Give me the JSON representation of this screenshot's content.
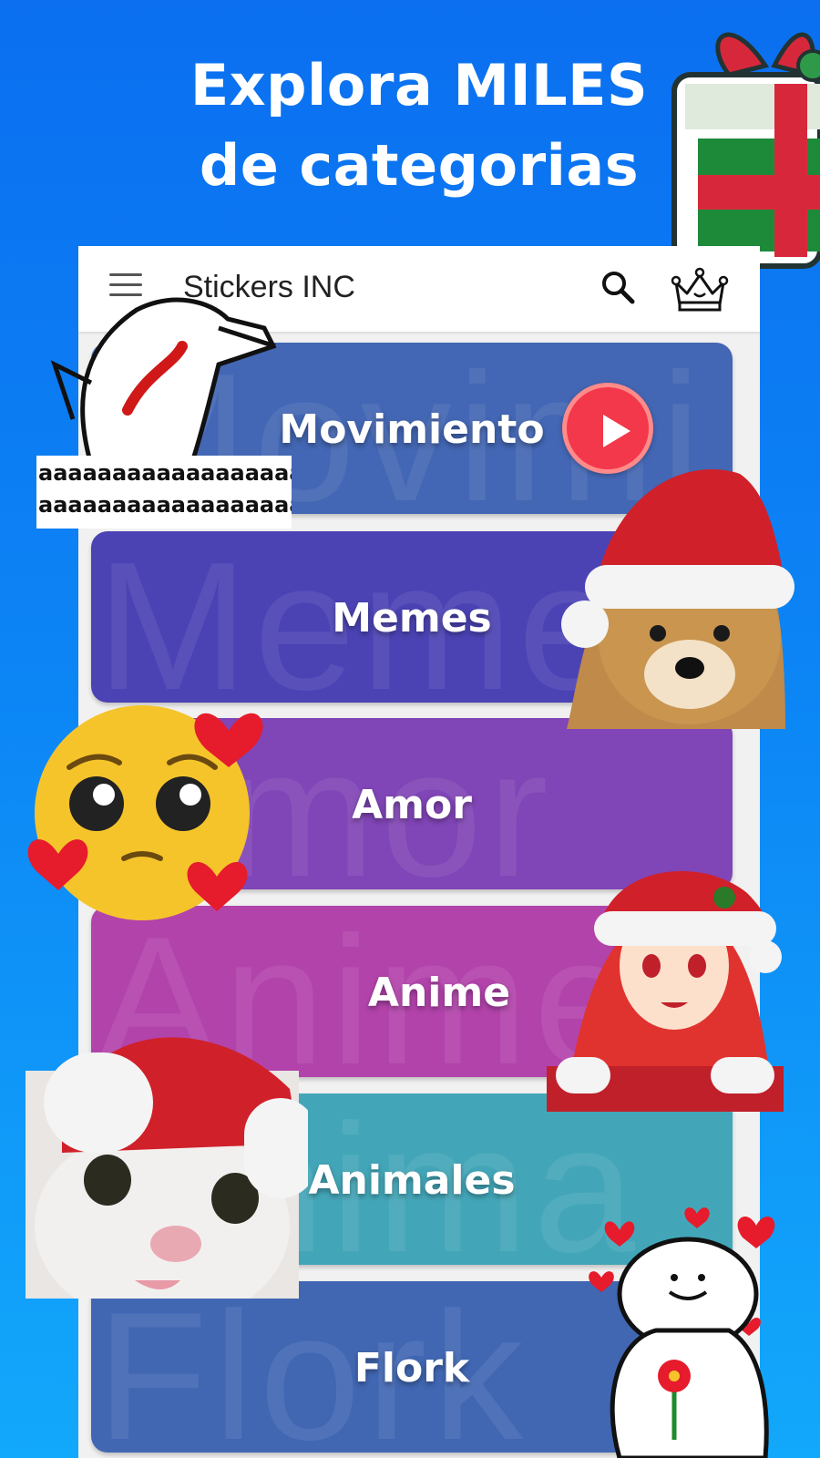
{
  "headline": {
    "line1": "Explora MILES",
    "line2": "de categorias"
  },
  "appbar": {
    "title": "Stickers INC",
    "icons": [
      "menu-icon",
      "search-icon",
      "crown-icon"
    ]
  },
  "categories": [
    {
      "label": "Movimiento",
      "color": "#4367b4",
      "ghost": "Movimi"
    },
    {
      "label": "Memes",
      "color": "#4b43b4",
      "ghost": "Meme"
    },
    {
      "label": "Amor",
      "color": "#8045b6",
      "ghost": "Amor"
    },
    {
      "label": "Anime",
      "color": "#b243ab",
      "ghost": "Anime"
    },
    {
      "label": "Animales",
      "color": "#43a6b8",
      "ghost": "Anima"
    },
    {
      "label": "Flork",
      "color": "#4167b3",
      "ghost": "Flork"
    }
  ],
  "stickers": {
    "flork_scream_text": "aaaaaaaaaaaaaaaaaaaaaaaaaa",
    "names": [
      "gift-sticker",
      "flork-scream-sticker",
      "play-button",
      "santa-dog-sticker",
      "pleading-emoji-sticker",
      "anime-santa-girl-sticker",
      "santa-cat-sticker",
      "flork-flower-sticker"
    ]
  },
  "colors": {
    "background": "#0c84f5",
    "accent_red": "#f2384a"
  }
}
